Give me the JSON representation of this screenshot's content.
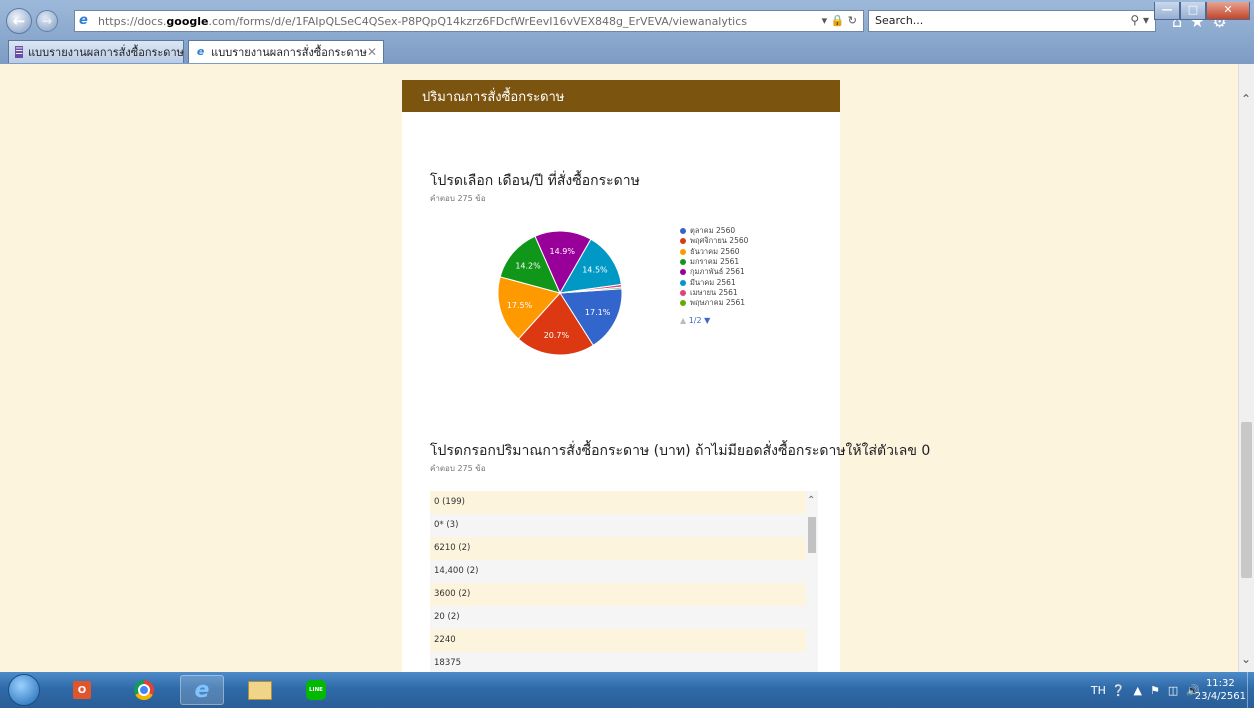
{
  "browser": {
    "url_prefix": "https://docs.",
    "url_domain": "google",
    "url_rest": ".com/forms/d/e/1FAIpQLSeC4QSex-P8PQpQ14kzrz6FDcfWrEevI16vVEX848g_ErVEVA/viewanalytics",
    "search_placeholder": "Search...",
    "tabs": [
      {
        "title": "แบบรายงานผลการสั่งซื้อกระดาษ"
      },
      {
        "title": "แบบรายงานผลการสั่งซื้อกระดาษ"
      }
    ]
  },
  "form": {
    "section_title": "ปริมาณการสั่งซื้อกระดาษ",
    "q1": {
      "title": "โปรดเลือก เดือน/ปี ที่สั่งซื้อกระดาษ",
      "count": "คำตอบ 275 ข้อ"
    },
    "q2": {
      "title": "โปรดกรอกปริมาณการสั่งซื้อกระดาษ (บาท) ถ้าไม่มียอดสั่งซื้อกระดาษให้ใส่ตัวเลข 0",
      "count": "คำตอบ 275 ข้อ"
    },
    "responses": [
      "0 (199)",
      "0* (3)",
      "6210 (2)",
      "14,400 (2)",
      "3600 (2)",
      "20 (2)",
      "2240",
      "18375"
    ],
    "legend_pager": "1/2"
  },
  "chart_data": {
    "type": "pie",
    "categories": [
      "ตุลาคม 2560",
      "พฤศจิกายน 2560",
      "ธันวาคม 2560",
      "มกราคม 2561",
      "กุมภาพันธ์ 2561",
      "มีนาคม 2561",
      "เมษายน 2561",
      "พฤษภาคม 2561"
    ],
    "values": [
      17.1,
      20.7,
      17.5,
      14.2,
      14.9,
      14.5,
      0.7,
      0.4
    ],
    "labels": [
      "17.1%",
      "20.7%",
      "17.5%",
      "14.2%",
      "14.9%",
      "14.5%",
      "",
      ""
    ],
    "colors": [
      "#3366cc",
      "#dc3912",
      "#ff9900",
      "#109618",
      "#990099",
      "#0099c6",
      "#dd4477",
      "#66aa00"
    ],
    "legend_position": "right"
  },
  "taskbar": {
    "language": "TH",
    "time": "11:32",
    "date": "23/4/2561"
  }
}
